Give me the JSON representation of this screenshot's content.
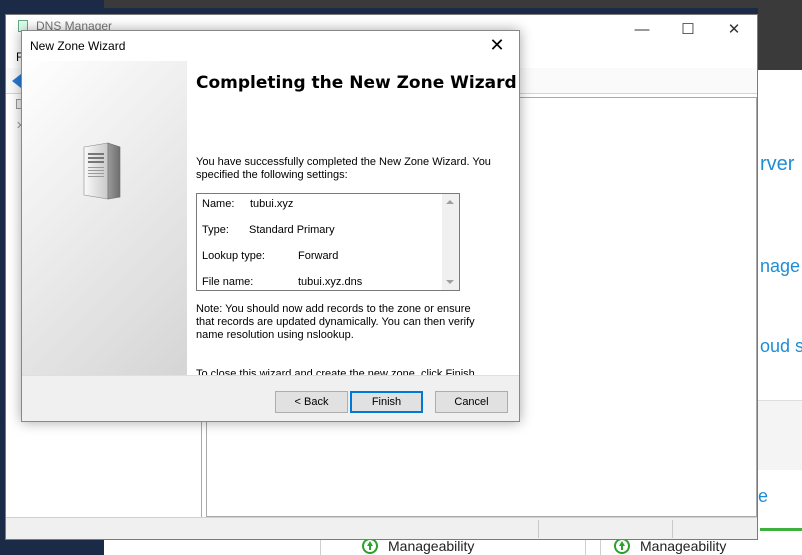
{
  "background": {
    "server_manager": {
      "fragments": [
        "rver",
        "nage",
        "oud se",
        "e"
      ],
      "manageability_label": "Manageability"
    }
  },
  "dns_manager": {
    "title": "DNS Manager",
    "menu_char": "F",
    "controls": {
      "minimize": "—",
      "maximize": "☐",
      "close": "✕"
    }
  },
  "wizard": {
    "title": "New Zone Wizard",
    "close_glyph": "✕",
    "heading": "Completing the New Zone Wizard",
    "intro": "You have successfully completed the New Zone Wizard. You specified the following settings:",
    "settings": [
      {
        "label": "Name:",
        "value": "tubui.xyz"
      },
      {
        "label": "Type:",
        "value": "Standard Primary"
      },
      {
        "label": "Lookup type:",
        "value": "Forward"
      },
      {
        "label": "File name:",
        "value": "tubui.xyz.dns"
      }
    ],
    "note": "Note: You should now add records to the zone or ensure that records are updated dynamically. You can then verify name resolution using nslookup.",
    "closing": "To close this wizard and create the new zone, click Finish.",
    "buttons": {
      "back": "< Back",
      "finish": "Finish",
      "cancel": "Cancel"
    },
    "icons": {
      "side_image": "server-tower-icon",
      "scroll_up": "chevron-up-icon",
      "scroll_down": "chevron-down-icon"
    },
    "colors": {
      "default_button_border": "#0078d7"
    }
  }
}
